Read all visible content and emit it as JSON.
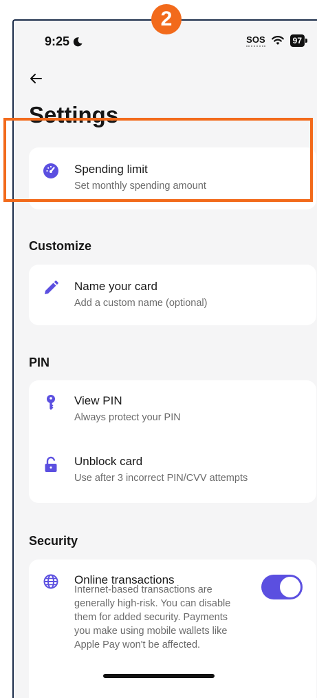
{
  "step_badge": "2",
  "status_bar": {
    "time": "9:25",
    "sos": "SOS",
    "battery": "97"
  },
  "header": {
    "title": "Settings"
  },
  "spending": {
    "label": "Spending limit",
    "sub": "Set monthly spending amount"
  },
  "customize": {
    "heading": "Customize",
    "name_card": {
      "label": "Name your card",
      "sub": "Add a custom name (optional)"
    }
  },
  "pin": {
    "heading": "PIN",
    "view_pin": {
      "label": "View PIN",
      "sub": "Always protect your PIN"
    },
    "unblock": {
      "label": "Unblock card",
      "sub": "Use after 3 incorrect PIN/CVV attempts"
    }
  },
  "security": {
    "heading": "Security",
    "online": {
      "label": "Online transactions",
      "desc": "Internet-based transactions are generally high-risk. You can disable them for added security. Payments you make using mobile wallets like Apple Pay won't be affected.",
      "enabled": true
    }
  },
  "colors": {
    "accent": "#5b4fe0",
    "highlight": "#f26a1b",
    "background": "#f5f5f6"
  },
  "icons": {
    "spending": "speedometer-icon",
    "name": "pencil-icon",
    "view_pin": "key-icon",
    "unblock": "unlock-icon",
    "online": "globe-icon",
    "back": "arrow-left-icon"
  }
}
